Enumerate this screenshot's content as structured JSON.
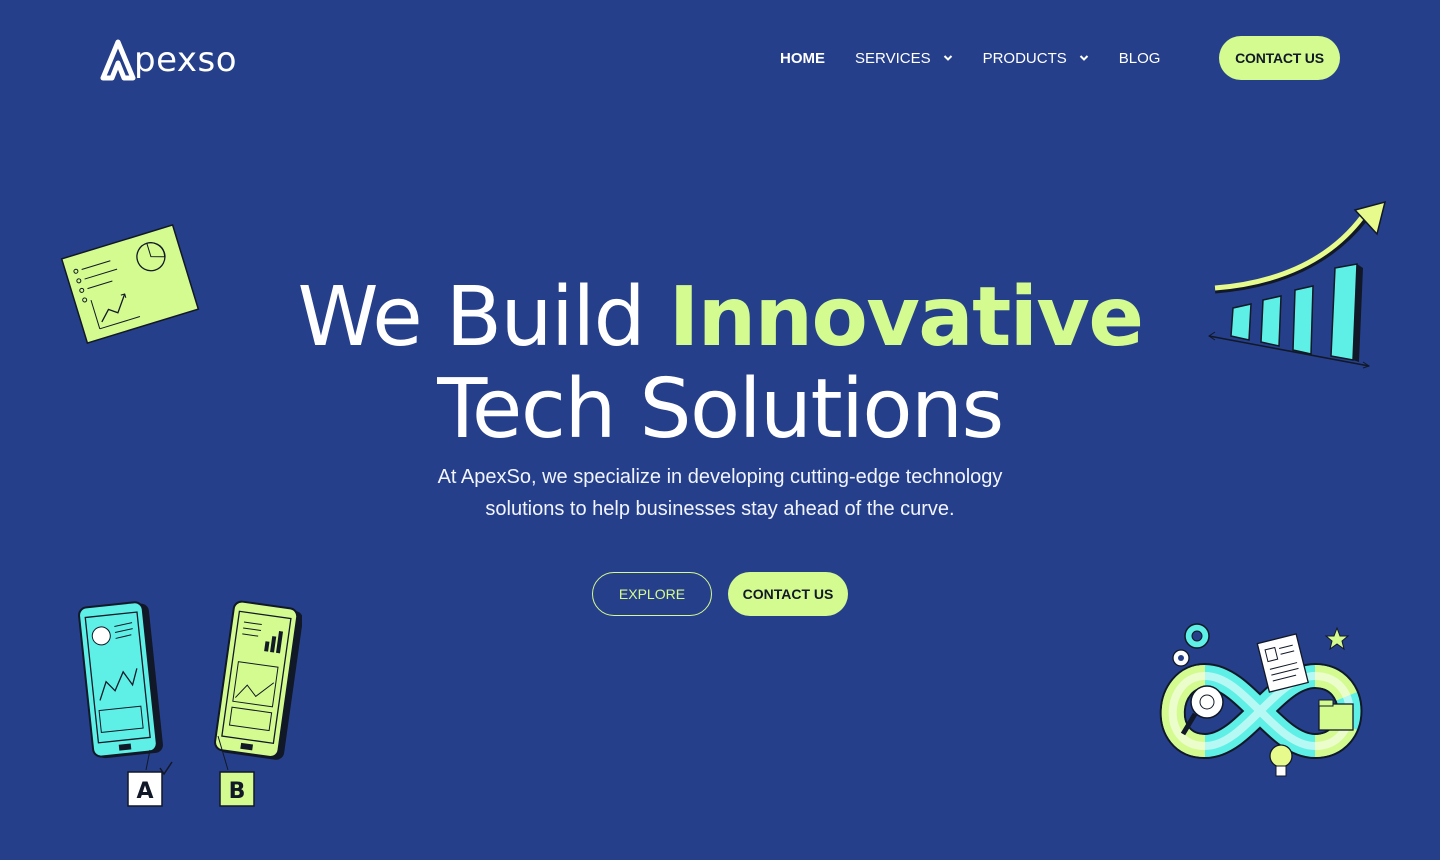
{
  "brand": {
    "name": "pexso",
    "accent": "#d4fb8f",
    "background": "#263f8a"
  },
  "nav": {
    "items": [
      {
        "label": "HOME"
      },
      {
        "label": "SERVICES"
      },
      {
        "label": "PRODUCTS"
      },
      {
        "label": "BLOG"
      }
    ],
    "cta_label": "CONTACT US"
  },
  "hero": {
    "title_line1_plain": "We Build ",
    "title_line1_accent": "Innovative",
    "title_line2": "Tech Solutions",
    "subtitle_line1": "At ApexSo, we specialize in developing cutting-edge technology",
    "subtitle_line2": "solutions to help businesses stay ahead of the curve.",
    "explore_label": "EXPLORE",
    "contact_label": "CONTACT US"
  },
  "illustrations": {
    "tablet_labels": [
      "A",
      "B"
    ],
    "icons": [
      "report-sheet-icon",
      "growth-chart-icon",
      "ab-test-phones-icon",
      "infinity-workflow-icon"
    ]
  }
}
